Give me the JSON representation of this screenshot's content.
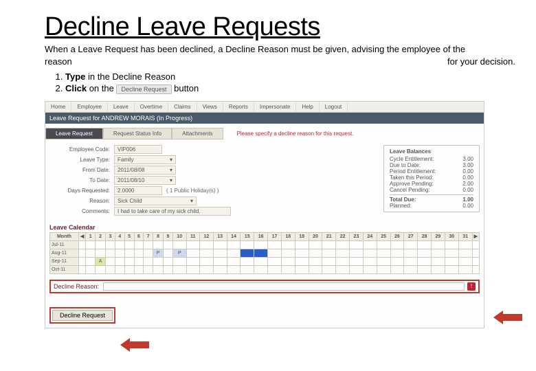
{
  "title": "Decline Leave Requests",
  "intro1": "When a Leave Request has been declined, a Decline Reason must be given, advising the employee of the",
  "intro2a": "reason",
  "intro2b": "for your decision.",
  "steps": {
    "s1a": "Type",
    "s1b": " in the Decline Reason",
    "s2a": "Click",
    "s2b": " on the ",
    "s2btn": "Decline Request",
    "s2c": " button"
  },
  "menu": [
    "Home",
    "Employee",
    "Leave",
    "Overtime",
    "Claims",
    "Views",
    "Reports",
    "Impersonate",
    "Help",
    "Logout"
  ],
  "headerbar": "Leave Request for ANDREW MORAIS (In Progress)",
  "tabs": {
    "t1": "Leave Request",
    "t2": "Request Status Info",
    "t3": "Attachments"
  },
  "validation_msg": "Please specify a decline reason for this request.",
  "form": {
    "emp_code_label": "Employee Code:",
    "emp_code": "VIP006",
    "leave_type_label": "Leave Type:",
    "leave_type": "Family",
    "from_label": "From Date:",
    "from": "2011/08/08",
    "to_label": "To Date:",
    "to": "2011/08/10",
    "days_label": "Days Requested:",
    "days": "2.0000",
    "days_note": "( 1 Public Holiday(s) )",
    "reason_label": "Reason:",
    "reason": "Sick Child",
    "comments_label": "Comments:",
    "comments": "I had to take care of my sick child."
  },
  "balances": {
    "title": "Leave Balances",
    "lines": [
      {
        "k": "Cycle Entitlement:",
        "v": "3.00"
      },
      {
        "k": "Due to Date:",
        "v": "3.00"
      },
      {
        "k": "Period Entitlement:",
        "v": "0.00"
      },
      {
        "k": "Taken this Period:",
        "v": "0.00"
      },
      {
        "k": "Approve Pending:",
        "v": "2.00"
      },
      {
        "k": "Cancel Pending:",
        "v": "0.00"
      }
    ],
    "total_k": "Total Due:",
    "total_v": "1.00",
    "planned_k": "Planned:",
    "planned_v": "0.00"
  },
  "calendar": {
    "label": "Leave Calendar",
    "cols": [
      "1",
      "2",
      "3",
      "4",
      "5",
      "6",
      "7",
      "8",
      "9",
      "10",
      "11",
      "12",
      "13",
      "14",
      "15",
      "16",
      "17",
      "18",
      "19",
      "20",
      "21",
      "22",
      "23",
      "24",
      "25",
      "26",
      "27",
      "28",
      "29",
      "30",
      "31"
    ],
    "rows": [
      {
        "m": "Jul-11",
        "cells": {}
      },
      {
        "m": "Aug-11",
        "cells": {
          "8": "P",
          "10": "P",
          "15": "blue",
          "16": "blue"
        }
      },
      {
        "m": "Sep-11",
        "cells": {
          "2": "A"
        }
      },
      {
        "m": "Oct-11",
        "cells": {}
      }
    ],
    "month_header": "Month"
  },
  "decline": {
    "label": "Decline Reason:",
    "value": "",
    "err": "!"
  },
  "decline_btn": "Decline Request"
}
